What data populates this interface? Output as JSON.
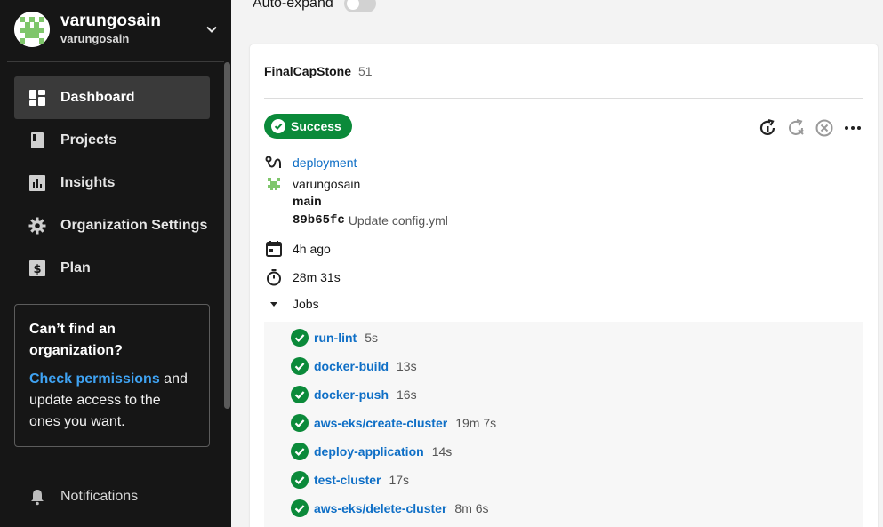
{
  "account": {
    "name": "varungosain",
    "org": "varungosain"
  },
  "sidebar": {
    "items": [
      {
        "label": "Dashboard",
        "icon": "dashboard-icon",
        "active": true
      },
      {
        "label": "Projects",
        "icon": "book-icon",
        "active": false
      },
      {
        "label": "Insights",
        "icon": "bar-chart-icon",
        "active": false
      },
      {
        "label": "Organization Settings",
        "icon": "gear-icon",
        "active": false
      },
      {
        "label": "Plan",
        "icon": "dollar-icon",
        "active": false
      }
    ],
    "org_box": {
      "title": "Can’t find an organization?",
      "link": "Check permissions",
      "rest": " and update access to the ones you want."
    },
    "notifications": "Notifications"
  },
  "main": {
    "auto_expand_label": "Auto-expand",
    "auto_expand_on": false
  },
  "pipeline": {
    "project": "FinalCapStone",
    "number": "51",
    "status": "Success",
    "workflow": "deployment",
    "author": "varungosain",
    "branch": "main",
    "commit_hash": "89b65fc",
    "commit_message": "Update config.yml",
    "time_ago": "4h ago",
    "duration": "28m 31s",
    "jobs_label": "Jobs"
  },
  "jobs": [
    {
      "name": "run-lint",
      "duration": "5s"
    },
    {
      "name": "docker-build",
      "duration": "13s"
    },
    {
      "name": "docker-push",
      "duration": "16s"
    },
    {
      "name": "aws-eks/create-cluster",
      "duration": "19m 7s"
    },
    {
      "name": "deploy-application",
      "duration": "14s"
    },
    {
      "name": "test-cluster",
      "duration": "17s"
    },
    {
      "name": "aws-eks/delete-cluster",
      "duration": "8m 6s"
    }
  ],
  "colors": {
    "success": "#0b8a3a",
    "link": "#0f6fc6",
    "sidebar_bg": "#161616",
    "org_link": "#3fa3f3"
  }
}
